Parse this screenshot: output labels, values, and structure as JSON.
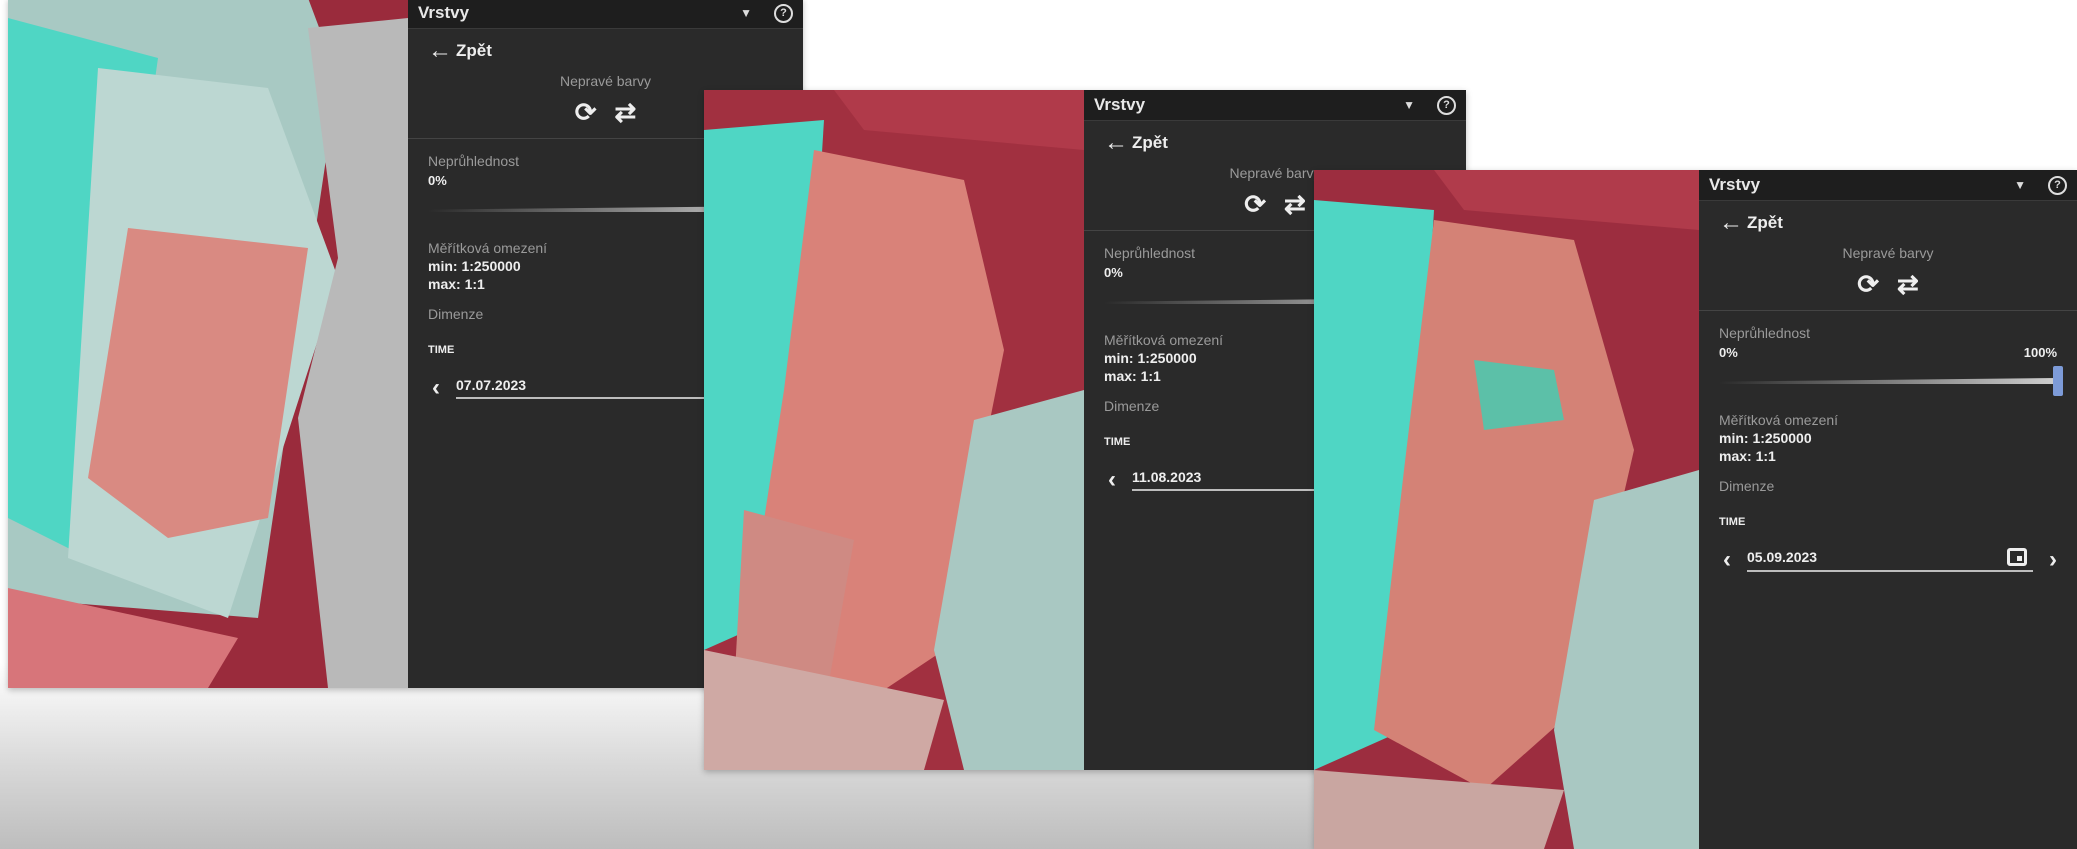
{
  "screens": [
    {
      "panel_title": "Vrstvy",
      "back_label": "Zpět",
      "style_name": "Nepravé barvy",
      "opacity_label": "Neprůhlednost",
      "opacity_min": "0%",
      "opacity_max": "",
      "opacity_value": 1.0,
      "scale_label": "Měřítková omezení",
      "scale_min": "min: 1:250000",
      "scale_max": "max: 1:1",
      "dimension_label": "Dimenze",
      "time_label": "TIME",
      "date": "07.07.2023"
    },
    {
      "panel_title": "Vrstvy",
      "back_label": "Zpět",
      "style_name": "Nepravé barvy",
      "opacity_label": "Neprůhlednost",
      "opacity_min": "0%",
      "opacity_max": "",
      "opacity_value": 1.0,
      "scale_label": "Měřítková omezení",
      "scale_min": "min: 1:250000",
      "scale_max": "max: 1:1",
      "dimension_label": "Dimenze",
      "time_label": "TIME",
      "date": "11.08.2023"
    },
    {
      "panel_title": "Vrstvy",
      "back_label": "Zpět",
      "style_name": "Nepravé barvy",
      "opacity_label": "Neprůhlednost",
      "opacity_min": "0%",
      "opacity_max": "100%",
      "opacity_value": 1.0,
      "scale_label": "Měřítková omezení",
      "scale_min": "min: 1:250000",
      "scale_max": "max: 1:1",
      "dimension_label": "Dimenze",
      "time_label": "TIME",
      "date": "05.09.2023"
    }
  ],
  "icons": {
    "back": "arrow-left-icon",
    "reset": "reset-icon",
    "refresh": "refresh-icon",
    "help": "help-icon",
    "dropdown": "chevron-down-icon",
    "prev": "chevron-left-icon",
    "next": "chevron-right-icon",
    "calendar": "calendar-icon"
  },
  "colors": {
    "panel_bg": "#2a2a2a",
    "slider_thumb": "#7d9bd8",
    "map_field": "#d98279",
    "map_water": "#4fd6c4",
    "map_grass": "#a9c8c2"
  }
}
